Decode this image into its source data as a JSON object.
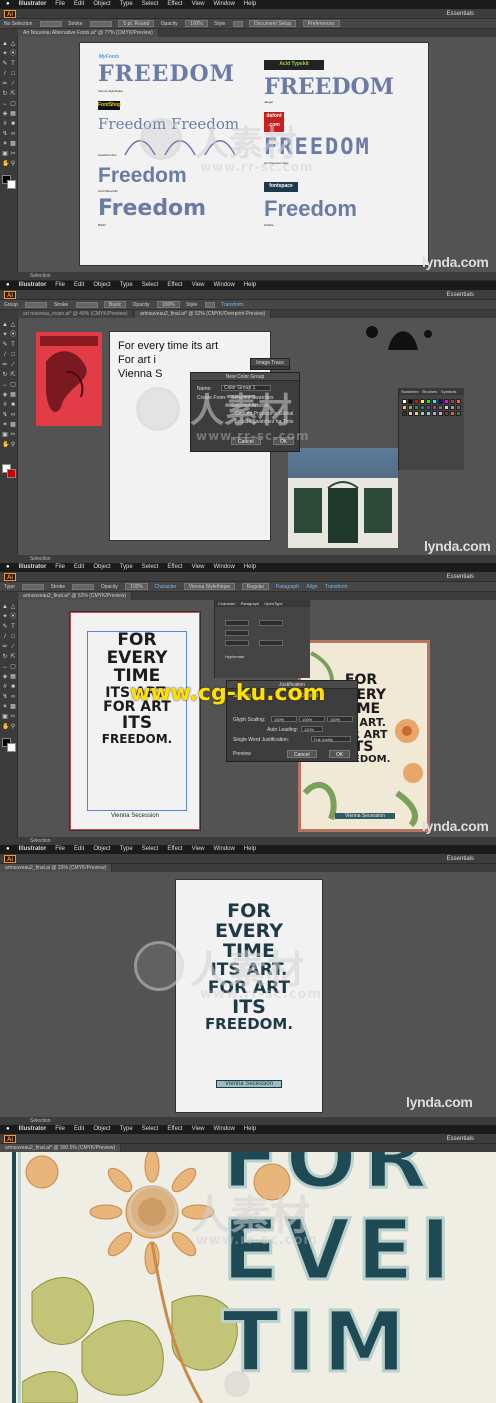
{
  "menu": {
    "apple": "",
    "app": "Illustrator",
    "items": [
      "File",
      "Edit",
      "Object",
      "Type",
      "Select",
      "Effect",
      "View",
      "Window",
      "Help"
    ]
  },
  "watermarks": {
    "cn": "人素材",
    "url": "www.rr-sc.com",
    "cg": "www.cg-ku.com",
    "lynda": "lynda.com"
  },
  "panel1": {
    "essentials": "Essentials",
    "control": {
      "selection": "No Selection",
      "stroke": "Stroke",
      "stroke_val": "5 pt. Round",
      "opacity": "Opacity",
      "opacity_val": "100%",
      "style": "Style",
      "doc_setup": "Document Setup",
      "prefs": "Preferences"
    },
    "tab": "Art Nouveau Alternative Fonts.ai* @ 77% (CMYK/Preview)",
    "status": "Selection",
    "freedoms": [
      {
        "text": "FREEDOM",
        "credit": "Vienna Stylethique"
      },
      {
        "text": "Freedom Freedom",
        "credit": "Aesthetic Wor"
      },
      {
        "text": "Freedom",
        "credit": "Arizol Bouchlin"
      },
      {
        "text": "Freedom",
        "credit": "Bobbi"
      },
      {
        "text": "FREEDOM",
        "credit": "Jaeger"
      },
      {
        "text": "FREEDOM",
        "credit": "Art Nouveau Caps"
      },
      {
        "text": "Freedom",
        "credit": "Zrodde"
      }
    ],
    "logos": {
      "myfonts": "MyFonts",
      "font_shop": "FontShop",
      "acid": "Acid Typekit",
      "dafont": "dafont .com",
      "fontspace": "fontspace"
    }
  },
  "panel2": {
    "essentials": "Essentials",
    "control": {
      "selection": "Group",
      "stroke": "Stroke",
      "basic": "Basic",
      "opacity": "Opacity",
      "opacity_val": "100%",
      "style": "Style",
      "transform": "Transform"
    },
    "tabs": [
      "art nouveau_inspo.ai* @ 49% (CMYK/Preview)",
      "artnouveau2_final.ai* @ 52% (CMYK/Overprint Preview)"
    ],
    "status": "Selection",
    "poster_text": [
      "For every time its art",
      "For art i",
      "Vienna S"
    ],
    "image_trace_title": "Image Trace",
    "dialog": {
      "title": "New Color Group",
      "name_label": "Name:",
      "name_val": "Color Group 1",
      "create_from": "Create From:",
      "selected_swatches": "Selected Swatches",
      "selected_artwork": "Selected Artwork",
      "convert": "Convert Process to Global",
      "include": "Include Swatches for Tints",
      "cancel": "Cancel",
      "ok": "OK"
    },
    "swatch_tabs": [
      "Swatches",
      "Brushes",
      "Symbols"
    ],
    "swatch_colors": [
      "#ffffff",
      "#000000",
      "#ff0000",
      "#ffff00",
      "#00ff00",
      "#00ffff",
      "#0000ff",
      "#ff00ff",
      "#c8302e",
      "#e8742a",
      "#f3c33b",
      "#7ab648",
      "#2e8b57",
      "#2f6fb5",
      "#6a3d9a",
      "#b03a7a",
      "#8c6b4a",
      "#cfcfcf",
      "#999999",
      "#666666",
      "#333333",
      "#f6b6a0",
      "#e9d36b",
      "#a9d08e",
      "#9fc5e8",
      "#b4a7d6",
      "#d5a6bd",
      "#5b4636",
      "#e65f3c",
      "#3b7a57"
    ]
  },
  "panel3": {
    "essentials": "Essentials",
    "control": {
      "selection": "Type",
      "stroke": "Stroke",
      "opacity": "Opacity",
      "opacity_val": "100%",
      "character": "Character",
      "font": "Vienna Stylethique",
      "style_val": "Regular",
      "paragraph": "Paragraph",
      "align": "Align",
      "transform": "Transform"
    },
    "tab": "artnouveau2_final.ai* @ 52% (CMYK/Preview)",
    "status": "Selection",
    "poster_lines": [
      "FOR",
      "EVERY",
      "TIME",
      "ITS ART.",
      "FOR ART",
      "ITS",
      "FREEDOM."
    ],
    "poster_footer": "Vienna Secession",
    "paragraph_tabs": [
      "Character",
      "Paragraph",
      "OpenType"
    ],
    "hyphenate": "Hyphenate",
    "justification": {
      "title": "Justification",
      "spacing": "Spacing",
      "desired": "Desired",
      "glyph": "Glyph Scaling:",
      "g1": "100%",
      "g2": "100%",
      "g3": "100%",
      "auto_leading": "Auto Leading:",
      "auto_val": "120%",
      "single": "Single Word Justification:",
      "single_val": "Full Justify",
      "preview": "Preview",
      "cancel": "Cancel",
      "ok": "OK"
    }
  },
  "panel4": {
    "essentials": "Essentials",
    "tab": "artnouveau2_final.ai @ 33% (CMYK/Preview)",
    "status": "Selection",
    "poster_lines": [
      "FOR",
      "EVERY",
      "TIME",
      "ITS ART.",
      "FOR ART",
      "ITS",
      "FREEDOM."
    ],
    "poster_footer": "Vienna Secession"
  },
  "panel5": {
    "essentials": "Essentials",
    "tab": "artnouveau2_final.ai* @ 300.5% (CMYK/Preview)",
    "big_text": [
      "FOR",
      "EVEI",
      "TIM"
    ]
  }
}
